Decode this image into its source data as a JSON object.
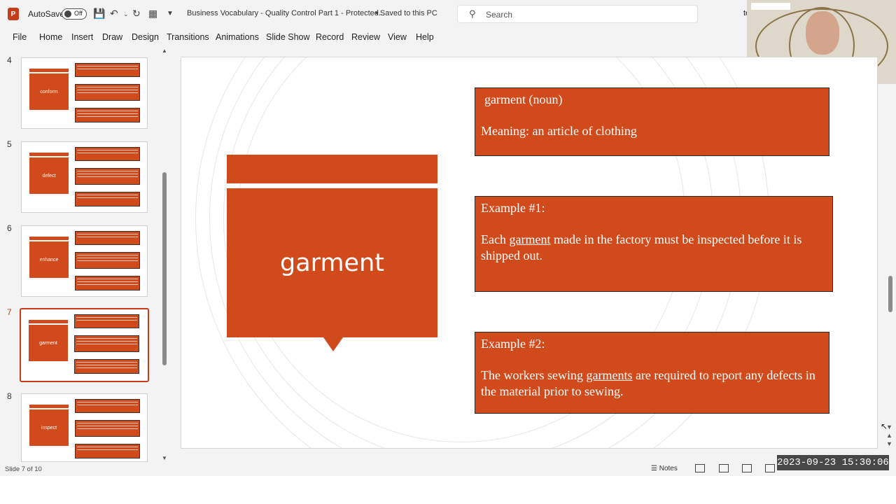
{
  "titlebar": {
    "autosave_label": "AutoSave",
    "toggle_state": "Off",
    "doc_title": "Business Vocabulary - Quality Control Part 1  -  Protected...",
    "saved_status": "•  Saved to this PC",
    "search_placeholder": "Search",
    "user_initial": "te"
  },
  "ribbon": {
    "tabs": [
      "File",
      "Home",
      "Insert",
      "Draw",
      "Design",
      "Transitions",
      "Animations",
      "Slide Show",
      "Record",
      "Review",
      "View",
      "Help"
    ]
  },
  "thumbnails": [
    {
      "number": "4",
      "word": "conform"
    },
    {
      "number": "5",
      "word": "defect"
    },
    {
      "number": "6",
      "word": "enhance"
    },
    {
      "number": "7",
      "word": "garment"
    },
    {
      "number": "8",
      "word": "inspect"
    }
  ],
  "slide": {
    "word": "garment",
    "definition": {
      "heading": "garment (noun)",
      "meaning": "Meaning: an article of clothing"
    },
    "example1": {
      "heading": "Example #1:",
      "pre": "Each ",
      "term": "garment",
      "post": " made in the factory must be inspected before it is shipped out."
    },
    "example2": {
      "heading": "Example #2:",
      "pre": "The workers sewing ",
      "term": "garments",
      "post": " are required to report any defects in the material prior to sewing."
    }
  },
  "status": {
    "slide_counter": "Slide 7 of 10",
    "notes_label": "Notes",
    "timestamp": "2023-09-23  15:30:06"
  },
  "colors": {
    "accent": "#d14a1c",
    "app_accent": "#c43e1c"
  }
}
